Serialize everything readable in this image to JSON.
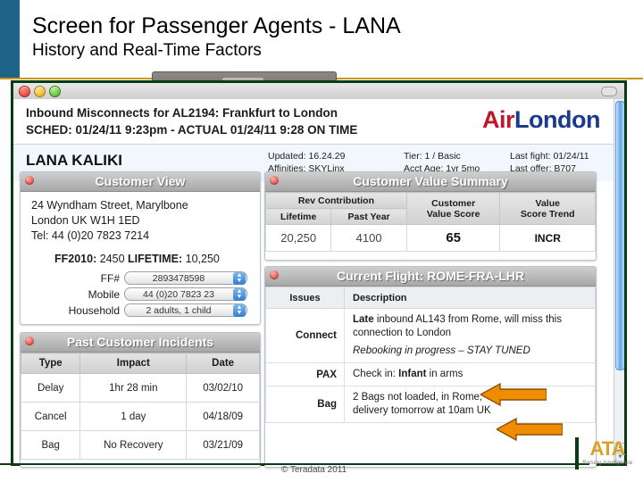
{
  "slide": {
    "title": "Screen for Passenger Agents - LANA",
    "subtitle": "History and Real-Time Factors",
    "copyright": "© Teradata 2011",
    "logo": {
      "mark": "ATA",
      "tagline": "Raising Intelligence"
    }
  },
  "window": {
    "traffic_lights": [
      "close",
      "minimize",
      "zoom"
    ]
  },
  "banner": {
    "line1": "Inbound Misconnects for AL2194: Frankfurt to London",
    "line2": "SCHED: 01/24/11 9:23pm  -  ACTUAL 01/24/11 9:28 ON TIME",
    "brand_first": "Air",
    "brand_second": "London",
    "brand_first_color": "#C0162A",
    "brand_second_color": "#1B3A8C"
  },
  "customer": {
    "name": "LANA KALIKI",
    "meta": [
      {
        "label": "Updated:",
        "value": "16.24.29"
      },
      {
        "label": "Affinities:",
        "value": "SKYLinx"
      },
      {
        "label": "Tier:",
        "value": "1 / Basic"
      },
      {
        "label": "Acct Age:",
        "value": "1yr 5mo"
      },
      {
        "label": "Last fight:",
        "value": "01/24/11"
      },
      {
        "label": "Last offer:",
        "value": "B707"
      }
    ],
    "meta_lines": {
      "c1_top": "Updated: 16.24.29",
      "c1_bot": "Affinities: SKYLinx",
      "c2_top": "Tier: 1 / Basic",
      "c2_bot": "Acct Age: 1yr 5mo",
      "c3_top": "Last fight: 01/24/11",
      "c3_bot": "Last offer:  B707"
    }
  },
  "customer_view": {
    "title": "Customer View",
    "address_line1": "24 Wyndham Street, Marylbone",
    "address_line2": "London UK W1H 1ED",
    "phone": "Tel: 44 (0)20 7823 7214",
    "ff_summary_label1": "FF2010:",
    "ff_summary_value1": "2450",
    "ff_summary_label2": "LIFETIME:",
    "ff_summary_value2": "10,250",
    "fields": [
      {
        "label": "FF#",
        "value": "2893478598"
      },
      {
        "label": "Mobile",
        "value": "44 (0)20 7823 23"
      },
      {
        "label": "Household",
        "value": "2 adults, 1 child"
      }
    ]
  },
  "past_incidents": {
    "title": "Past Customer Incidents",
    "columns": [
      "Type",
      "Impact",
      "Date"
    ],
    "rows": [
      [
        "Delay",
        "1hr 28 min",
        "03/02/10"
      ],
      [
        "Cancel",
        "1 day",
        "04/18/09"
      ],
      [
        "Bag",
        "No Recovery",
        "03/21/09"
      ]
    ]
  },
  "value_summary": {
    "title": "Customer Value Summary",
    "group_header": "Rev Contribution",
    "columns": [
      "Lifetime",
      "Past Year",
      "Customer Value Score",
      "Value Score Trend"
    ],
    "col3_line1": "Customer",
    "col3_line2": "Value Score",
    "col4_line1": "Value",
    "col4_line2": "Score Trend",
    "values": {
      "lifetime": "20,250",
      "past_year": "4100",
      "value_score": "65",
      "trend": "INCR"
    }
  },
  "current_flight": {
    "title": "Current Flight: ROME-FRA-LHR",
    "columns": [
      "Issues",
      "Description"
    ],
    "rows": [
      {
        "issue": "Connect",
        "desc_bold": "Late",
        "desc_main": " inbound AL143 from Rome, will miss this connection to London",
        "desc_sub": "Rebooking in progress – STAY TUNED",
        "arrow": false
      },
      {
        "issue": "PAX",
        "desc_prefix": "Check in: ",
        "desc_bold_part": "Infant",
        "desc_suffix": " in arms",
        "arrow": true
      },
      {
        "issue": "Bag",
        "desc_line1": "2 Bags not loaded, in Rome,",
        "desc_line2": "delivery tomorrow at 10am UK",
        "arrow": true
      }
    ]
  },
  "colors": {
    "accent_blue_bar": "#1E6285",
    "gold_rule": "#C9971C",
    "window_border_green": "#0B3C11",
    "arrow_orange": "#F08C00",
    "arrow_orange_border": "#A85B00"
  }
}
